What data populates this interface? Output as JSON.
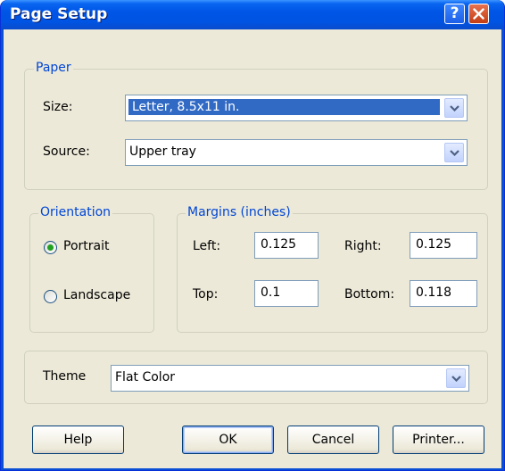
{
  "window": {
    "title": "Page Setup"
  },
  "paper": {
    "legend": "Paper",
    "size_label": "Size:",
    "size_value": "Letter, 8.5x11 in.",
    "source_label": "Source:",
    "source_value": "Upper tray"
  },
  "orientation": {
    "legend": "Orientation",
    "portrait_label": "Portrait",
    "landscape_label": "Landscape",
    "selected": "Portrait"
  },
  "margins": {
    "legend": "Margins (inches)",
    "left_label": "Left:",
    "left_value": "0.125",
    "right_label": "Right:",
    "right_value": "0.125",
    "top_label": "Top:",
    "top_value": "0.1",
    "bottom_label": "Bottom:",
    "bottom_value": "0.118"
  },
  "theme": {
    "label": "Theme",
    "value": "Flat Color"
  },
  "buttons": {
    "help": "Help",
    "ok": "OK",
    "cancel": "Cancel",
    "printer": "Printer..."
  },
  "colors": {
    "title_bar": "#0054e3",
    "dialog_bg": "#ece9d8",
    "legend_text": "#0046d5",
    "selection": "#316ac5",
    "radio_dot": "#21a121"
  },
  "icons": [
    "help-icon",
    "close-icon",
    "dropdown-arrow-icon"
  ]
}
